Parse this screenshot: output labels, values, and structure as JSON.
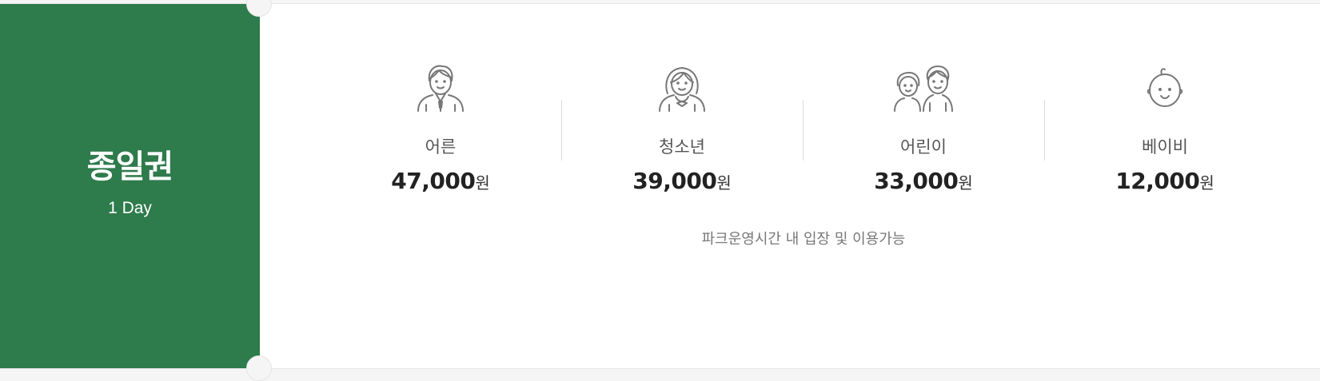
{
  "ticket": {
    "name": "종일권",
    "sub": "1 Day",
    "colors": {
      "accent": "#2e7b4c",
      "icon_stroke": "#777777"
    }
  },
  "prices": [
    {
      "label": "어른",
      "amount": "47,000",
      "unit": "원",
      "icon": "adult-icon"
    },
    {
      "label": "청소년",
      "amount": "39,000",
      "unit": "원",
      "icon": "teen-icon"
    },
    {
      "label": "어린이",
      "amount": "33,000",
      "unit": "원",
      "icon": "child-icon"
    },
    {
      "label": "베이비",
      "amount": "12,000",
      "unit": "원",
      "icon": "baby-icon"
    }
  ],
  "note": "파크운영시간 내 입장 및 이용가능"
}
